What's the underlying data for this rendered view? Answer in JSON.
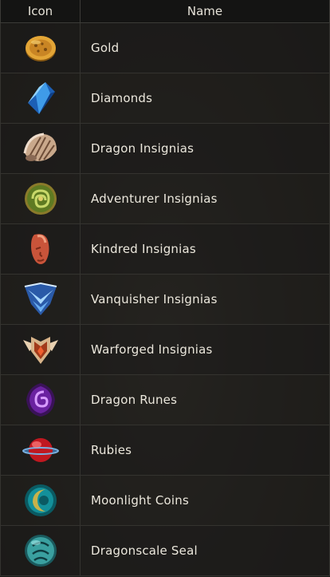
{
  "header": {
    "icon_label": "Icon",
    "name_label": "Name"
  },
  "rows": [
    {
      "name": "Gold",
      "icon": "gold-coin-icon"
    },
    {
      "name": "Diamonds",
      "icon": "diamond-icon"
    },
    {
      "name": "Dragon Insignias",
      "icon": "shell-icon"
    },
    {
      "name": "Adventurer Insignias",
      "icon": "green-knot-icon"
    },
    {
      "name": "Kindred Insignias",
      "icon": "face-mask-icon"
    },
    {
      "name": "Vanquisher Insignias",
      "icon": "blue-chevron-emblem-icon"
    },
    {
      "name": "Warforged Insignias",
      "icon": "winged-shield-icon"
    },
    {
      "name": "Dragon Runes",
      "icon": "purple-rune-icon"
    },
    {
      "name": "Rubies",
      "icon": "ruby-orb-icon"
    },
    {
      "name": "Moonlight Coins",
      "icon": "moonlight-coin-icon"
    },
    {
      "name": "Dragonscale Seal",
      "icon": "dragonscale-seal-icon"
    }
  ]
}
